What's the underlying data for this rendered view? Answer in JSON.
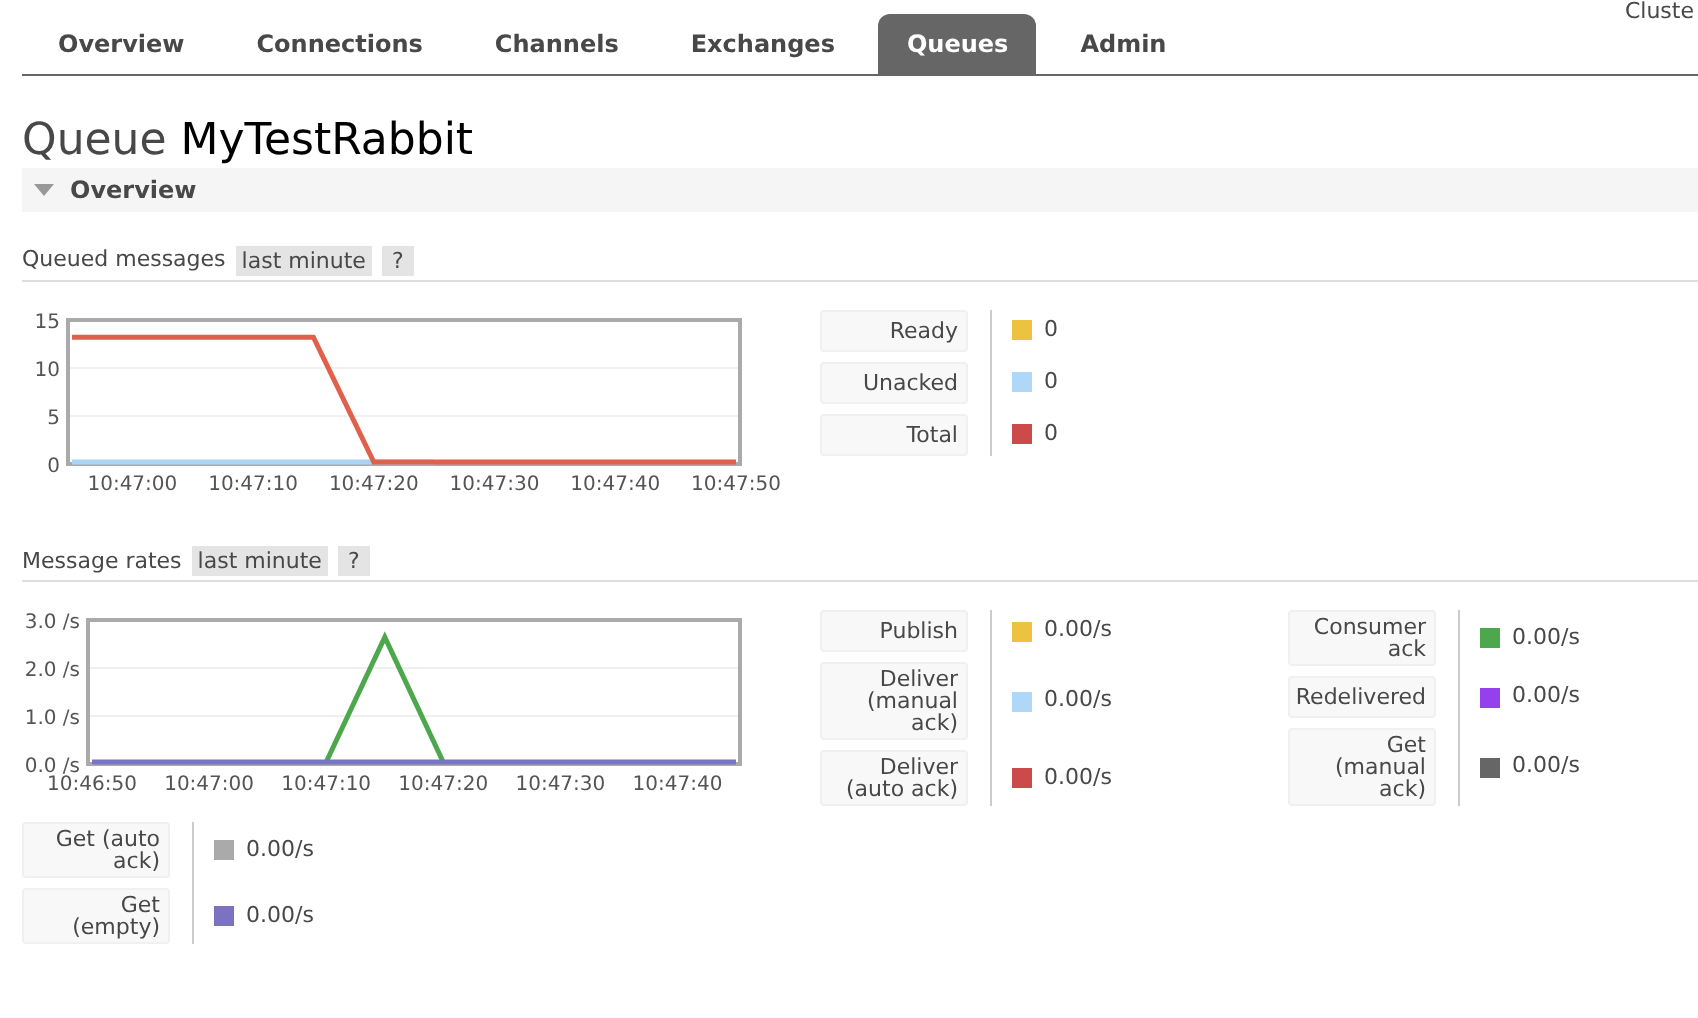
{
  "corner_text": "Cluste",
  "tabs": [
    {
      "label": "Overview",
      "selected": false
    },
    {
      "label": "Connections",
      "selected": false
    },
    {
      "label": "Channels",
      "selected": false
    },
    {
      "label": "Exchanges",
      "selected": false
    },
    {
      "label": "Queues",
      "selected": true
    },
    {
      "label": "Admin",
      "selected": false
    }
  ],
  "page_title": {
    "prefix": "Queue",
    "name": "MyTestRabbit"
  },
  "section": {
    "title": "Overview",
    "expanded": true
  },
  "panels": [
    {
      "title": "Queued messages",
      "range": "last minute",
      "help": "?",
      "chart_data": {
        "type": "line",
        "categories": [
          null,
          "10:47:00",
          null,
          "10:47:10",
          null,
          "10:47:20",
          null,
          "10:47:30",
          null,
          "10:47:40",
          null,
          "10:47:50"
        ],
        "ylim": [
          0,
          15
        ],
        "yticks": [
          {
            "value": 0,
            "label": "0"
          },
          {
            "value": 5,
            "label": "5"
          },
          {
            "value": 10,
            "label": "10"
          },
          {
            "value": 15,
            "label": "15"
          }
        ],
        "series": [
          {
            "color": "#aad4f5",
            "values": [
              0,
              0,
              0,
              0,
              0,
              0,
              0,
              null,
              null,
              null,
              null,
              null
            ]
          },
          {
            "color": "#e0604c",
            "values": [
              13,
              13,
              13,
              13,
              13,
              0,
              0,
              0,
              0,
              0,
              0,
              0
            ]
          }
        ]
      },
      "legend_groups": [
        [
          {
            "label": "Ready",
            "value": "0",
            "color": "#edc240"
          },
          {
            "label": "Unacked",
            "value": "0",
            "color": "#afd8f8"
          },
          {
            "label": "Total",
            "value": "0",
            "color": "#cb4b4b"
          }
        ]
      ]
    },
    {
      "title": "Message rates",
      "range": "last minute",
      "help": "?",
      "chart_data": {
        "type": "line",
        "categories": [
          "10:46:50",
          null,
          "10:47:00",
          null,
          "10:47:10",
          null,
          "10:47:20",
          null,
          "10:47:30",
          null,
          "10:47:40",
          null
        ],
        "ylim": [
          0,
          3
        ],
        "yticks": [
          {
            "value": 0,
            "label": "0.0 /s"
          },
          {
            "value": 1,
            "label": "1.0 /s"
          },
          {
            "value": 2,
            "label": "2.0 /s"
          },
          {
            "value": 3,
            "label": "3.0 /s"
          }
        ],
        "series": [
          {
            "color": "#4da74d",
            "values": [
              null,
              null,
              null,
              null,
              0,
              2.6,
              0,
              null,
              null,
              null,
              null,
              null
            ]
          },
          {
            "color": "#7a74c4",
            "values": [
              0,
              0,
              0,
              0,
              0,
              0,
              0,
              0,
              0,
              0,
              0,
              0
            ]
          }
        ]
      },
      "legend_groups": [
        [
          {
            "label": "Publish",
            "value": "0.00/s",
            "color": "#edc240"
          },
          {
            "label": "Deliver (manual ack)",
            "value": "0.00/s",
            "color": "#afd8f8"
          },
          {
            "label": "Deliver (auto ack)",
            "value": "0.00/s",
            "color": "#cb4b4b"
          }
        ],
        [
          {
            "label": "Consumer ack",
            "value": "0.00/s",
            "color": "#4da74d"
          },
          {
            "label": "Redelivered",
            "value": "0.00/s",
            "color": "#9440ed"
          },
          {
            "label": "Get (manual ack)",
            "value": "0.00/s",
            "color": "#666666"
          }
        ],
        [
          {
            "label": "Get (auto ack)",
            "value": "0.00/s",
            "color": "#aaaaaa"
          },
          {
            "label": "Get (empty)",
            "value": "0.00/s",
            "color": "#7b73c2"
          }
        ]
      ]
    }
  ]
}
